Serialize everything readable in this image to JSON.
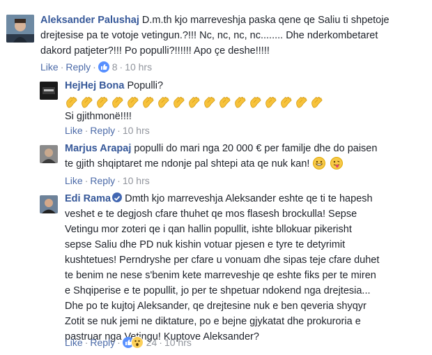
{
  "comments": [
    {
      "author": "Aleksander Palushaj",
      "text_first": "D.m.th kjo marreveshja paska qene qe Saliu ti shpetoje",
      "text_lines": [
        "drejtesise pa te votoje vetingun.?!!! Nc, nc, nc, nc........ Dhe nderkombetaret",
        "dakord patjeter?!!! Po populli?!!!!!! Apo çe deshe!!!!!"
      ],
      "like": "Like",
      "reply": "Reply",
      "reactions": "8",
      "time": "10 hrs"
    }
  ],
  "replies": [
    {
      "author": "HejHej Bona",
      "text_first": "Populli?",
      "emoji_name": "clapping-hands-emoji",
      "emoji_count": 17,
      "text_after": "Si gjithmonë!!!!",
      "like": "Like",
      "reply": "Reply",
      "time": "10 hrs"
    },
    {
      "author": "Marjus Arapaj",
      "text_first": "populli do mari nga 20 000 € per familje dhe do paisen",
      "text_lines": [
        "te gjith shqiptaret me ndonje pal shtepi ata qe nuk kan!"
      ],
      "like": "Like",
      "reply": "Reply",
      "time": "10 hrs"
    },
    {
      "author": "Edi Rama",
      "verified": true,
      "text_first": "Dmth kjo marreveshja Aleksander eshte qe ti te hapesh",
      "text_lines": [
        "veshet e te degjosh cfare thuhet qe mos flasesh brockulla! Sepse",
        "Vetingu mor zoteri qe i qan hallin popullit, ishte bllokuar pikerisht",
        "sepse Saliu dhe PD nuk kishin votuar pjesen e tyre te detyrimit",
        "kushtetues! Perndryshe per cfare u vonuam dhe sipas teje cfare duhet",
        "te benim ne nese s'benim kete marreveshje qe eshte fiks per te miren",
        "e Shqiperise e te popullit, jo per te shpetuar ndokend nga drejtesia...",
        "Dhe po te kujtoj Aleksander, qe drejtesine nuk e ben qeveria shyqyr",
        "Zotit se nuk jemi ne diktature, po e bejne gjykatat dhe prokuroria e",
        "pastruar nga Vetingu! Kuptove Aleksander?"
      ],
      "like": "Like",
      "reply": "Reply",
      "reactions": "24",
      "time": "10 hrs"
    }
  ]
}
